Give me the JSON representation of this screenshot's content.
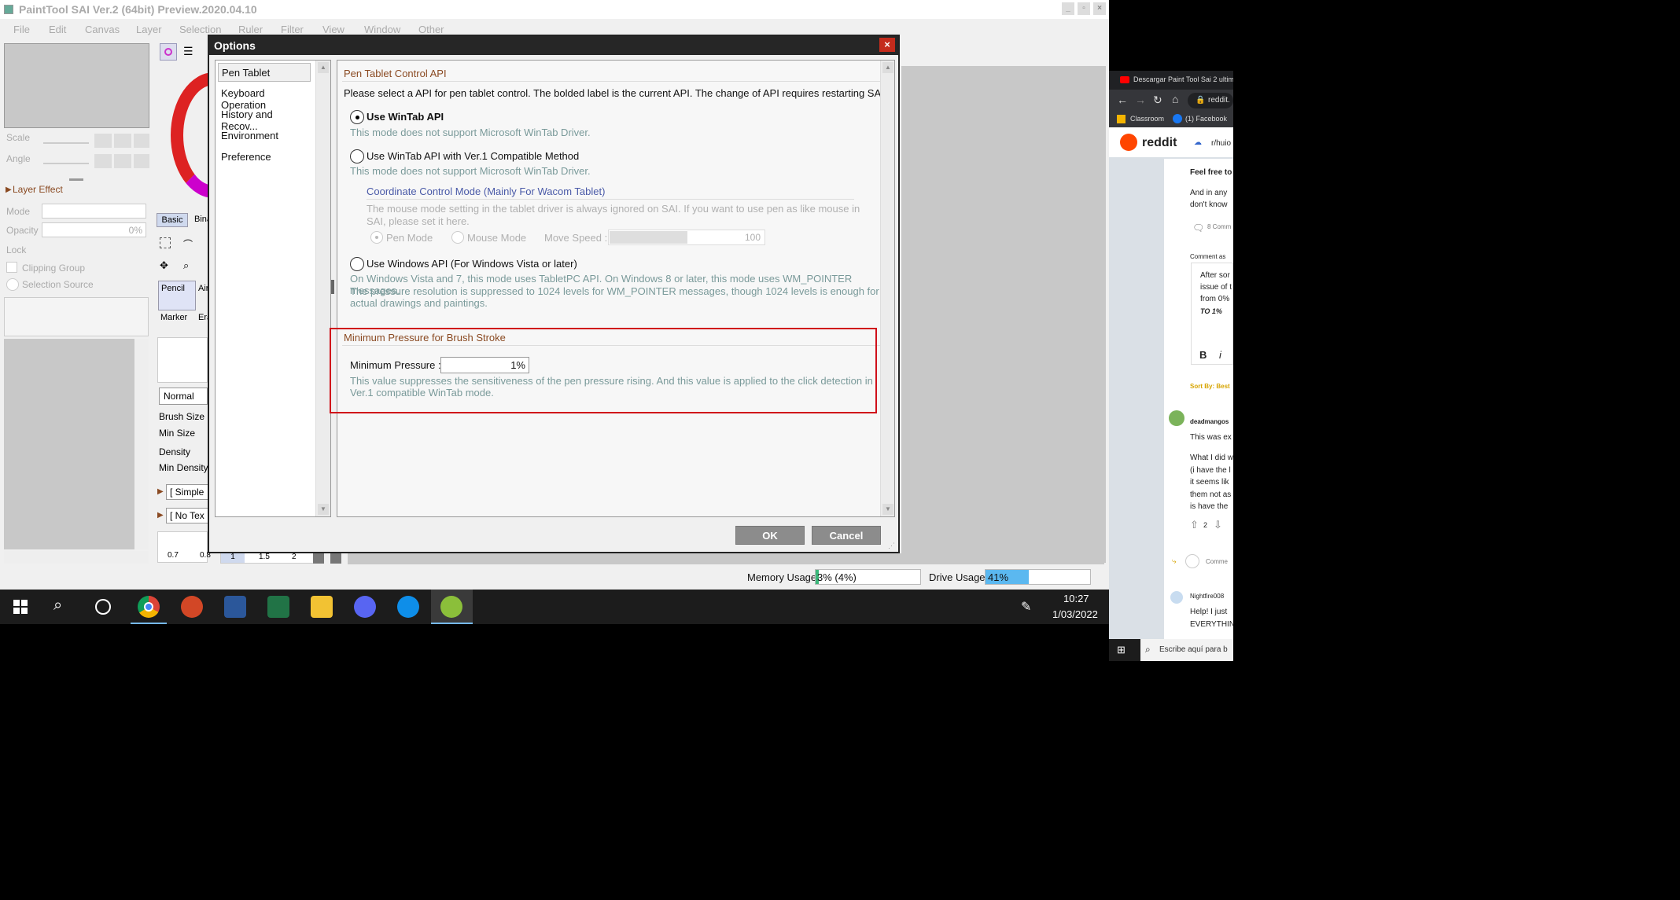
{
  "window": {
    "title": "PaintTool SAI Ver.2 (64bit) Preview.2020.04.10",
    "min": "_",
    "max": "▫",
    "close": "×"
  },
  "menu": [
    "File",
    "Edit",
    "Canvas",
    "Layer",
    "Selection",
    "Ruler",
    "Filter",
    "View",
    "Window",
    "Other"
  ],
  "left_panel": {
    "scale": "Scale",
    "angle": "Angle",
    "layer_effect": "Layer Effect",
    "mode": "Mode",
    "opacity": "Opacity",
    "opacity_value": "0%",
    "lock": "Lock",
    "clipping_group": "Clipping Group",
    "selection_source": "Selection Source"
  },
  "tool_panel": {
    "basic": "Basic",
    "binary": "Bina",
    "pencil": "Pencil",
    "air": "Air",
    "marker": "Marker",
    "eraser": "Era",
    "blend_mode": "Normal",
    "brush_size": "Brush Size",
    "min_size": "Min Size",
    "density": "Density",
    "min_density": "Min Density",
    "shape": "[ Simple",
    "texture": "[ No Tex",
    "sizes": [
      "0.7",
      "0.8",
      "1",
      "1.5",
      "2"
    ]
  },
  "dialog": {
    "title": "Options",
    "close": "×",
    "nav": [
      "Pen Tablet",
      "Keyboard Operation",
      "History and Recov...",
      "Environment",
      "Preference"
    ],
    "section1": {
      "title": "Pen Tablet Control API",
      "desc": "Please select a API for pen tablet control. The bolded label is the current API. The change of API requires restarting SAI.",
      "opt1_label": "Use WinTab API",
      "opt1_note": "This mode does not support Microsoft WinTab Driver.",
      "opt2_label": "Use WinTab API with Ver.1 Compatible Method",
      "opt2_note": "This mode does not support Microsoft WinTab Driver.",
      "coord_title": "Coordinate Control Mode (Mainly For Wacom Tablet)",
      "coord_note1": "The mouse mode setting in the tablet driver is always ignored on SAI. If you want to use pen as like mouse in",
      "coord_note2": "SAI, please set it here.",
      "pen_mode": "Pen Mode",
      "mouse_mode": "Mouse Mode",
      "move_speed": "Move Speed :",
      "move_speed_value": "100",
      "opt3_label": "Use Windows API (For Windows Vista or later)",
      "opt3_note1": "On Windows Vista and 7, this mode uses TabletPC API. On Windows 8 or later, this mode uses WM_POINTER messages.",
      "opt3_note2": "The pressure resolution is suppressed to 1024 levels for WM_POINTER messages, though 1024 levels is enough for",
      "opt3_note3": "actual drawings and paintings."
    },
    "section2": {
      "title": "Minimum Pressure for Brush Stroke",
      "label": "Minimum Pressure :",
      "value": "1%",
      "note1": "This value suppresses the sensitiveness of the pen pressure rising. And this value is applied to the click detection in",
      "note2": "Ver.1 compatible WinTab mode."
    },
    "ok": "OK",
    "cancel": "Cancel"
  },
  "status": {
    "memory_label": "Memory Usage",
    "memory_value": "3% (4%)",
    "memory_fraction": 0.03,
    "drive_label": "Drive Usage",
    "drive_value": "41%",
    "drive_fraction": 0.41
  },
  "taskbar": {
    "time": "10:27",
    "date": "1/03/2022",
    "search_placeholder": "Escribe aquí para b"
  },
  "browser": {
    "tab_title": "Descargar Paint Tool Sai 2 ultim",
    "url": "reddit.",
    "bookmarks": [
      "Classroom",
      "(1) Facebook"
    ],
    "brand": "reddit",
    "subreddit": "r/huio",
    "post_lines": [
      "Feel free to",
      "And in any",
      "don't know"
    ],
    "comments": "8 Comm",
    "comment_as": "Comment as",
    "draft": [
      "After sor",
      "issue of t",
      "from 0%",
      "TO 1%"
    ],
    "bold_btn": "B",
    "italic_btn": "i",
    "sort": "Sort By: Best",
    "user1": "deadmangos",
    "c1": [
      "This was ex",
      "",
      "What I did w",
      "(i have the l",
      "it seems lik",
      "them not as",
      "is have the"
    ],
    "votes": "2",
    "comment_btn": "Comme",
    "user2": "Nightfire008",
    "c2": [
      "Help! I just",
      "EVERYTHIN"
    ]
  },
  "colors": {
    "accent_red": "#d0101a",
    "dialog_title_bg": "#262626",
    "memory_bar": "#3ab87a",
    "drive_bar": "#5bb8f0"
  }
}
